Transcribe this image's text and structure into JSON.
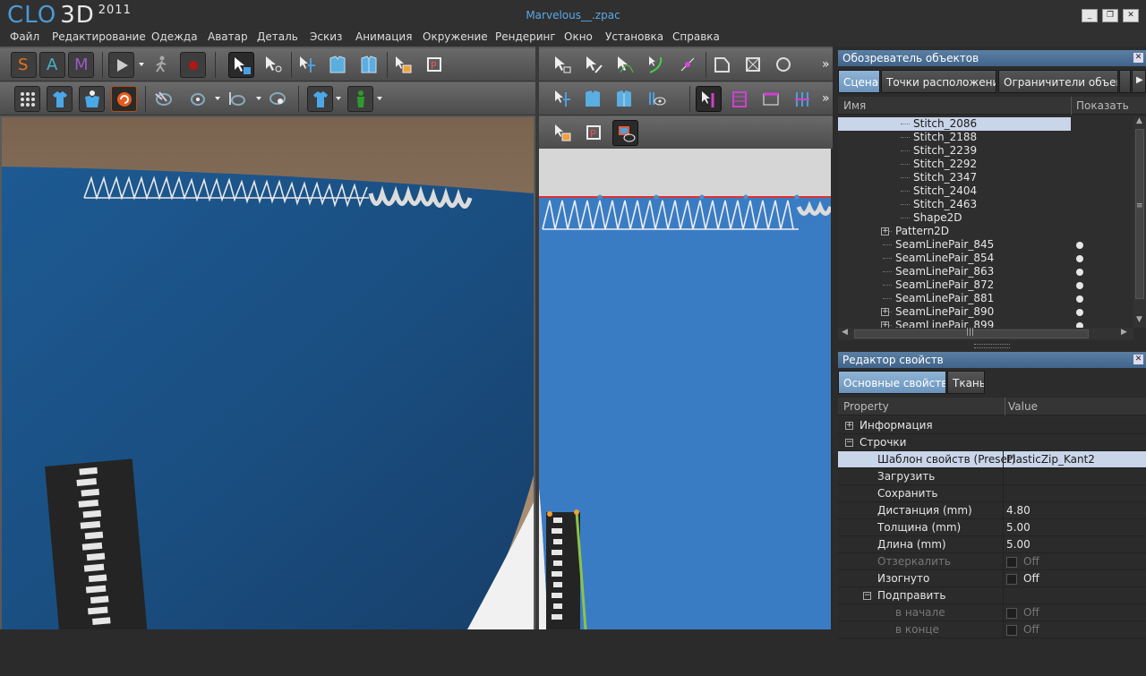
{
  "app": {
    "logo_text": "CLO",
    "logo_3d": "3D",
    "logo_year": "2011",
    "document_title": "Marvelous__.zpac"
  },
  "window_controls": {
    "minimize": "_",
    "restore": "❐",
    "close": "✕"
  },
  "menu": [
    "Файл",
    "Редактирование",
    "Одежда",
    "Аватар",
    "Деталь",
    "Эскиз",
    "Анимация",
    "Окружение",
    "Рендеринг",
    "Окно",
    "Установка",
    "Справка"
  ],
  "mode_buttons": {
    "s": "S",
    "a": "A",
    "m": "M"
  },
  "overflow": "»",
  "object_browser": {
    "title": "Обозреватель объектов",
    "close": "✕",
    "tabs": [
      "Сцена",
      "Точки расположения",
      "Ограничители объема"
    ],
    "columns": {
      "name": "Имя",
      "show": "Показать"
    },
    "rows": [
      {
        "label": "Stitch_2086",
        "selected": true,
        "show": false
      },
      {
        "label": "Stitch_2188",
        "show": false
      },
      {
        "label": "Stitch_2239",
        "show": false
      },
      {
        "label": "Stitch_2292",
        "show": false
      },
      {
        "label": "Stitch_2347",
        "show": false
      },
      {
        "label": "Stitch_2404",
        "show": false
      },
      {
        "label": "Stitch_2463",
        "show": false
      },
      {
        "label": "Shape2D",
        "show": false
      },
      {
        "label": "Pattern2D",
        "expander": "+",
        "show": false
      },
      {
        "label": "SeamLinePair_845",
        "show": true
      },
      {
        "label": "SeamLinePair_854",
        "show": true
      },
      {
        "label": "SeamLinePair_863",
        "show": true
      },
      {
        "label": "SeamLinePair_872",
        "show": true
      },
      {
        "label": "SeamLinePair_881",
        "show": true
      },
      {
        "label": "SeamLinePair_890",
        "expander": "+",
        "show": true
      },
      {
        "label": "SeamLinePair_899",
        "expander": "+",
        "show": true
      }
    ]
  },
  "property_editor": {
    "title": "Редактор свойств",
    "close": "✕",
    "tabs": [
      "Основные свойства",
      "Ткань"
    ],
    "columns": {
      "property": "Property",
      "value": "Value"
    },
    "rows": [
      {
        "name": "Информация",
        "expander": "+",
        "level": 0
      },
      {
        "name": "Строчки",
        "expander": "−",
        "level": 0
      },
      {
        "name": "Шаблон свойств (Preset)",
        "value": "PlasticZip_Kant2",
        "level": 1,
        "selected": true
      },
      {
        "name": "Загрузить",
        "value": "",
        "level": 1
      },
      {
        "name": "Сохранить",
        "value": "",
        "level": 1
      },
      {
        "name": "Дистанция (mm)",
        "value": "4.80",
        "level": 1
      },
      {
        "name": "Толщина (mm)",
        "value": "5.00",
        "level": 1
      },
      {
        "name": "Длина (mm)",
        "value": "5.00",
        "level": 1
      },
      {
        "name": "Отзеркалить",
        "value": "Off",
        "check": true,
        "disabled": true,
        "level": 1
      },
      {
        "name": "Изогнуто",
        "value": "Off",
        "check": true,
        "level": 1
      },
      {
        "name": "Подправить",
        "expander": "−",
        "level": 1
      },
      {
        "name": "в начале",
        "value": "Off",
        "check": true,
        "disabled": true,
        "level": 2
      },
      {
        "name": "в конце",
        "value": "Off",
        "check": true,
        "disabled": true,
        "level": 2
      }
    ]
  },
  "colors": {
    "accent_blue": "#4a9ad6",
    "selection": "#c9d5e8",
    "fabric": "#1e4f80",
    "tab_active": "#7ca3c9"
  }
}
